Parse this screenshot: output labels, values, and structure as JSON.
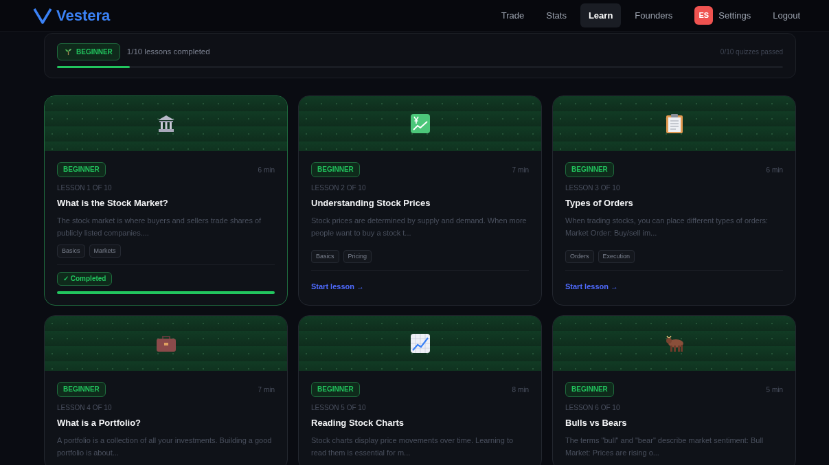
{
  "brand": {
    "name": "Vestera"
  },
  "nav": [
    {
      "label": "Trade",
      "kind": "link",
      "selected": false
    },
    {
      "label": "Stats",
      "kind": "link",
      "selected": false
    },
    {
      "label": "Learn",
      "kind": "link",
      "selected": true
    },
    {
      "label": "Founders",
      "kind": "link",
      "selected": false
    },
    {
      "label": "Settings",
      "kind": "profile",
      "avatar": "ES",
      "selected": false
    },
    {
      "label": "Logout",
      "kind": "link",
      "selected": false
    }
  ],
  "progress": {
    "level_badge": "BEGINNER",
    "lessons": "1/10 lessons completed",
    "quizzes": "0/10 quizzes passed",
    "level": 0.1
  },
  "lessons": [
    {
      "badge": "BEGINNER",
      "duration": "6 min",
      "number": "LESSON 1 OF 10",
      "title": "What is the Stock Market?",
      "description": "The stock market is where buyers and sellers trade shares of publicly listed companies....",
      "tags": [
        "Basics",
        "Markets"
      ],
      "completed": true,
      "status": "✓ Completed",
      "level": 1
    },
    {
      "badge": "BEGINNER",
      "duration": "7 min",
      "number": "LESSON 2 OF 10",
      "title": "Understanding Stock Prices",
      "description": "Stock prices are determined by supply and demand. When more people want to buy a stock t...",
      "tags": [
        "Basics",
        "Pricing"
      ],
      "completed": false,
      "action": "Start lesson →"
    },
    {
      "badge": "BEGINNER",
      "duration": "6 min",
      "number": "LESSON 3 OF 10",
      "title": "Types of Orders",
      "description": "When trading stocks, you can place different types of orders: Market Order: Buy/sell im...",
      "tags": [
        "Orders",
        "Execution"
      ],
      "completed": false,
      "action": "Start lesson →"
    },
    {
      "badge": "BEGINNER",
      "duration": "7 min",
      "number": "LESSON 4 OF 10",
      "title": "What is a Portfolio?",
      "description": "A portfolio is a collection of all your investments. Building a good portfolio is about..."
    },
    {
      "badge": "BEGINNER",
      "duration": "8 min",
      "number": "LESSON 5 OF 10",
      "title": "Reading Stock Charts",
      "description": "Stock charts display price movements over time. Learning to read them is essential for m..."
    },
    {
      "badge": "BEGINNER",
      "duration": "5 min",
      "number": "LESSON 6 OF 10",
      "title": "Bulls vs Bears",
      "description": "The terms \"bull\" and \"bear\" describe market sentiment: Bull Market: Prices are rising o..."
    }
  ]
}
